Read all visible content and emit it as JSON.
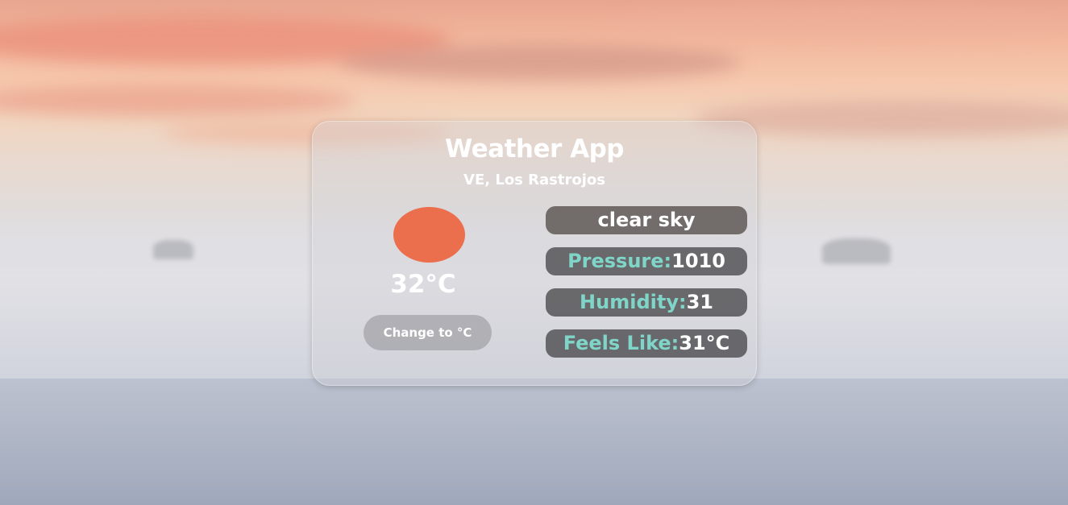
{
  "app": {
    "title": "Weather App",
    "location": "VE, Los Rastrojos"
  },
  "current": {
    "temperature": "32°C",
    "icon": "sun-icon",
    "unit_button_label": "Change to °C"
  },
  "details": {
    "description": "clear sky",
    "pressure_label": "Pressure:",
    "pressure_value": "1010",
    "humidity_label": "Humidity:",
    "humidity_value": "31",
    "feels_like_label": "Feels Like:",
    "feels_like_value": "31°C"
  },
  "colors": {
    "accent_label": "#7fd6c8",
    "sun": "#ec6f4d"
  }
}
